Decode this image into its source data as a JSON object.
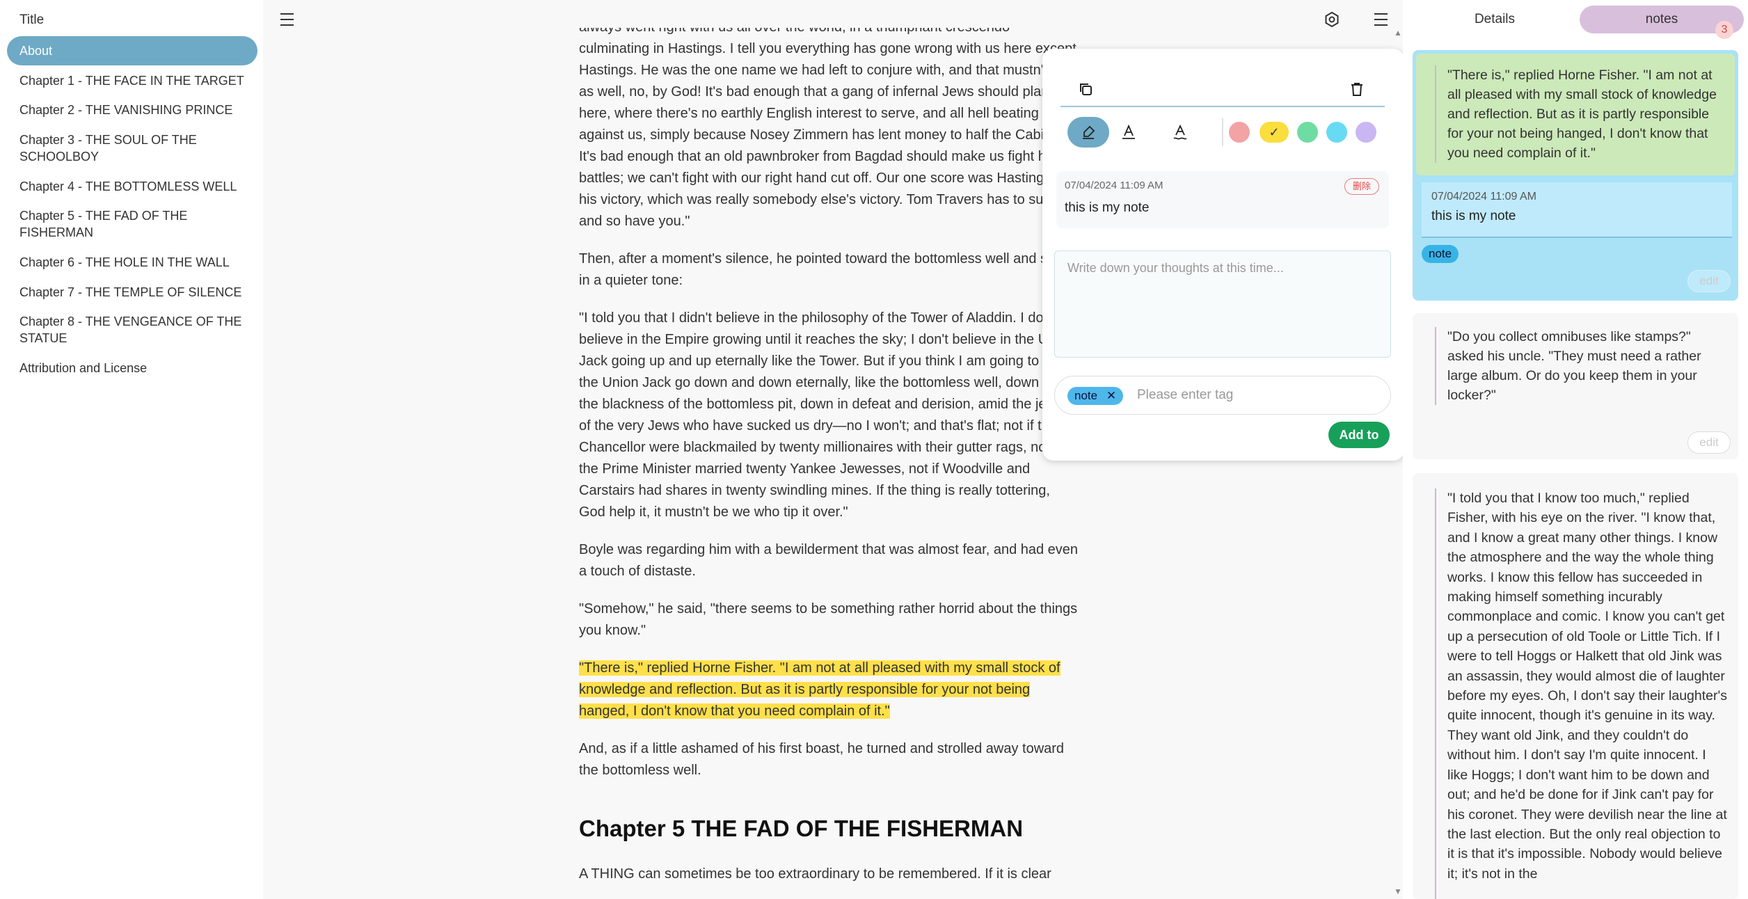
{
  "toc": {
    "title": "Title",
    "items": [
      {
        "label": "About",
        "active": true
      },
      {
        "label": "Chapter 1 - THE FACE IN THE TARGET"
      },
      {
        "label": "Chapter 2 - THE VANISHING PRINCE"
      },
      {
        "label": "Chapter 3 - THE SOUL OF THE SCHOOLBOY"
      },
      {
        "label": "Chapter 4 - THE BOTTOMLESS WELL"
      },
      {
        "label": "Chapter 5 - THE FAD OF THE FISHERMAN"
      },
      {
        "label": "Chapter 6 - THE HOLE IN THE WALL"
      },
      {
        "label": "Chapter 7 - THE TEMPLE OF SILENCE"
      },
      {
        "label": "Chapter 8 - THE VENGEANCE OF THE STATUE"
      },
      {
        "label": "Attribution and License"
      }
    ]
  },
  "reader": {
    "paragraphs": [
      "always went right with us all over the world, in a triumphant crescendo culminating in Hastings. I tell you everything has gone wrong with us here except Hastings. He was the one name we had left to conjure with, and that mustn't go as well, no, by God! It's bad enough that a gang of infernal Jews should plant us here, where there's no earthly English interest to serve, and all hell beating up against us, simply because Nosey Zimmern has lent money to half the Cabinet. It's bad enough that an old pawnbroker from Bagdad should make us fight his battles; we can't fight with our right hand cut off. Our one score was Hastings and his victory, which was really somebody else's victory. Tom Travers has to suffer, and so have you.\"",
      "Then, after a moment's silence, he pointed toward the bottomless well and said, in a quieter tone:",
      "\"I told you that I didn't believe in the philosophy of the Tower of Aladdin. I don't believe in the Empire growing until it reaches the sky; I don't believe in the Union Jack going up and up eternally like the Tower. But if you think I am going to let the Union Jack go down and down eternally, like the bottomless well, down into the blackness of the bottomless pit, down in defeat and derision, amid the jeers of the very Jews who have sucked us dry—no I won't; and that's flat; not if the Chancellor were blackmailed by twenty millionaires with their gutter rags, not if the Prime Minister married twenty Yankee Jewesses, not if Woodville and Carstairs had shares in twenty swindling mines. If the thing is really tottering, God help it, it mustn't be we who tip it over.\"",
      "Boyle was regarding him with a bewilderment that was almost fear, and had even a touch of distaste.",
      "\"Somehow,\" he said, \"there seems to be something rather horrid about the things you know.\""
    ],
    "highlighted": "\"There is,\" replied Horne Fisher. \"I am not at all pleased with my small stock of knowledge and reflection. But as it is partly responsible for your not being hanged, I don't know that you need complain of it.\"",
    "after": "And, as if a little ashamed of his first boast, he turned and strolled away toward the bottomless well.",
    "heading": "Chapter 5 THE FAD OF THE FISHERMAN",
    "tail": "A THING can sometimes be too extraordinary to be remembered. If it is clear"
  },
  "popup": {
    "colors": [
      "#f3a3a3",
      "#f9de3e",
      "#6fdca4",
      "#67dbf3",
      "#c8b7f3"
    ],
    "selected_color": 1,
    "note_time": "07/04/2024 11:09 AM",
    "delete_label": "删除",
    "note_text": "this is my note",
    "textarea_placeholder": "Write down your thoughts at this time...",
    "tag": "note",
    "tag_placeholder": "Please enter tag",
    "add_label": "Add to"
  },
  "panel": {
    "tab_details": "Details",
    "tab_notes": "notes",
    "badge_count": "3",
    "card1": {
      "quote": "\"There is,\" replied Horne Fisher. \"I am not at all pleased with my small stock of knowledge and reflection. But as it is partly responsible for your not being hanged, I don't know that you need complain of it.\"",
      "time": "07/04/2024 11:09 AM",
      "note": "this is my note",
      "tag": "note",
      "edit_label": "edit"
    },
    "card2": {
      "quote": "\"Do you collect omnibuses like stamps?\" asked his uncle. \"They must need a rather large album. Or do you keep them in your locker?\"",
      "edit_label": "edit"
    },
    "card3": {
      "quote": "\"I told you that I know too much,\" replied Fisher, with his eye on the river. \"I know that, and I know a great many other things. I know the atmosphere and the way the whole thing works. I know this fellow has succeeded in making himself something incurably commonplace and comic. I know you can't get up a persecution of old Toole or Little Tich. If I were to tell Hoggs or Halkett that old Jink was an assassin, they would almost die of laughter before my eyes. Oh, I don't say their laughter's quite innocent, though it's genuine in its way. They want old Jink, and they couldn't do without him. I don't say I'm quite innocent. I like Hoggs; I don't want him to be down and out; and he'd be done for if Jink can't pay for his coronet. They were devilish near the line at the last election. But the only real objection to it is that it's impossible. Nobody would believe it; it's not in the"
    }
  }
}
